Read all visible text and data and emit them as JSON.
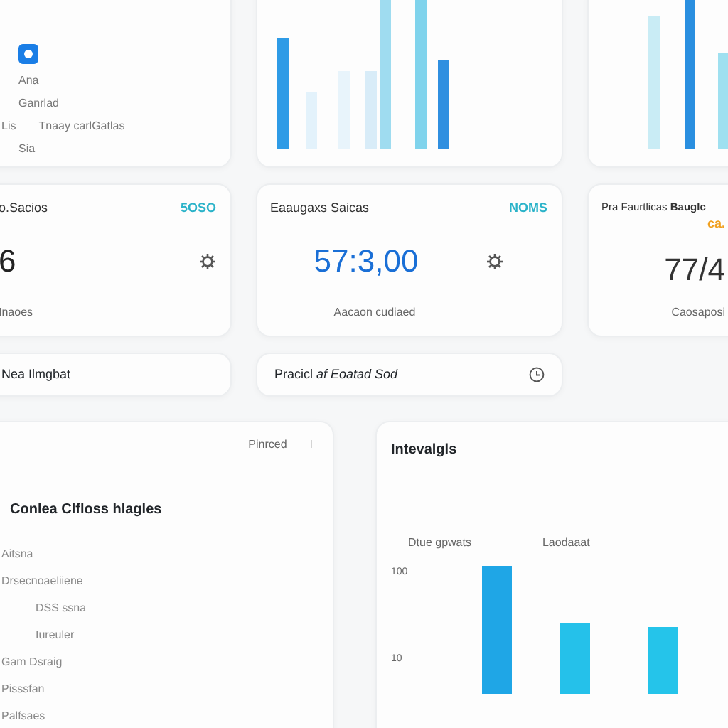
{
  "nav_card": {
    "items": [
      {
        "label": "Ana"
      },
      {
        "label": "Ganrlad"
      },
      {
        "label": "Tnaay carlGatlas",
        "prefix": "Lis"
      },
      {
        "label": "Sia"
      }
    ]
  },
  "stats": [
    {
      "label": "o.Sacios",
      "tag": "5OSO",
      "value": "6",
      "caption": "Inaoes"
    },
    {
      "label": "Eaaugaxs Saicas",
      "tag": "NOMS",
      "value": "57:3,00",
      "caption": "Aacaon cudiaed"
    },
    {
      "label": "Pra Faurtlicas **Bauglc**",
      "tag": "ca.",
      "value": "77/4",
      "caption": "Caosaposi"
    }
  ],
  "bars": [
    {
      "text": "Nea Ilmgbat"
    },
    {
      "text": "Pracicl *af Eoatad Sod*"
    }
  ],
  "list_card": {
    "action": "Pinrced",
    "action_mark": "I",
    "title": "Conlea Clfloss hlagles",
    "items": [
      {
        "label": "Aitsna"
      },
      {
        "label": "Drsecnoaeliiene",
        "children": [
          {
            "label": "DSS ssna"
          },
          {
            "label": "Iureuler"
          }
        ]
      },
      {
        "label": "Gam Dsraig"
      },
      {
        "label": "Pisssfan"
      },
      {
        "label": "Palfsaes"
      }
    ]
  },
  "chart_card": {
    "title": "Intevalgls",
    "legend": [
      "Dtue gpwats",
      "Laodaaat"
    ],
    "axis_labels": [
      "100",
      "10"
    ]
  }
}
